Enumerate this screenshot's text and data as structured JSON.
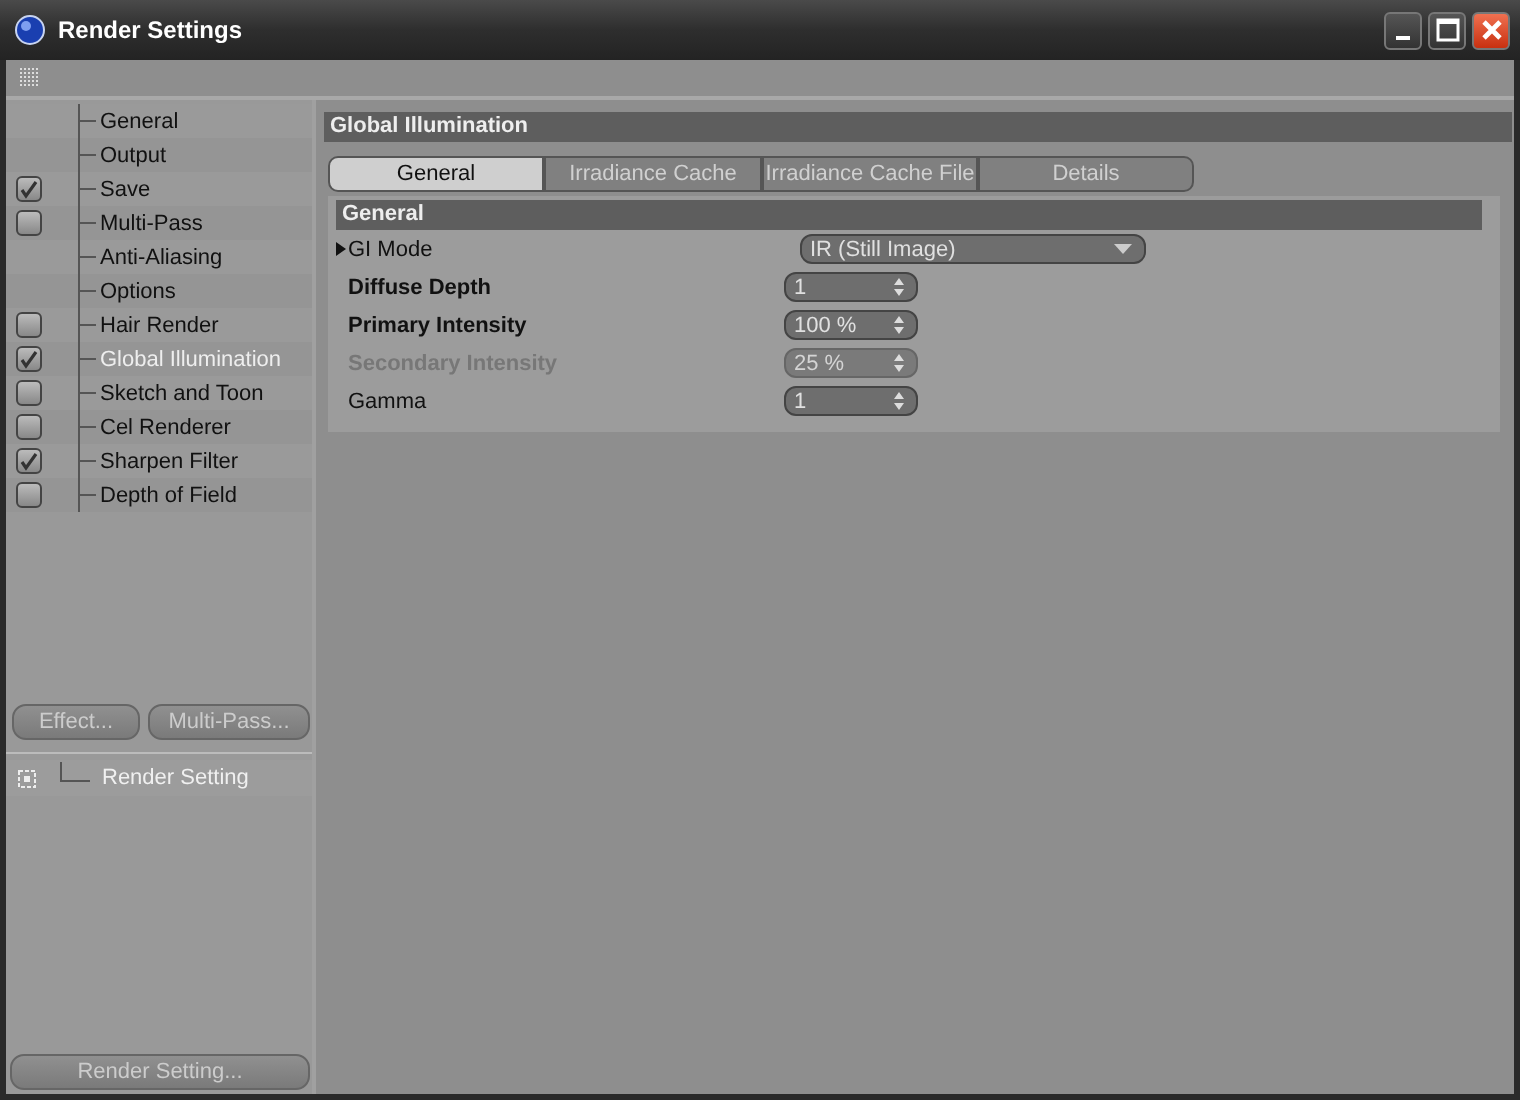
{
  "window": {
    "title": "Render Settings"
  },
  "sidebar": {
    "items": [
      {
        "label": "General",
        "kind": "plain",
        "selected": false
      },
      {
        "label": "Output",
        "kind": "plain",
        "selected": false
      },
      {
        "label": "Save",
        "kind": "checkbox",
        "checked": true,
        "selected": false
      },
      {
        "label": "Multi-Pass",
        "kind": "checkbox",
        "checked": false,
        "selected": false
      },
      {
        "label": "Anti-Aliasing",
        "kind": "plain",
        "selected": false
      },
      {
        "label": "Options",
        "kind": "plain",
        "selected": false
      },
      {
        "label": "Hair Render",
        "kind": "checkbox",
        "checked": false,
        "selected": false
      },
      {
        "label": "Global Illumination",
        "kind": "checkbox",
        "checked": true,
        "selected": true
      },
      {
        "label": "Sketch and Toon",
        "kind": "checkbox",
        "checked": false,
        "selected": false
      },
      {
        "label": "Cel Renderer",
        "kind": "checkbox",
        "checked": false,
        "selected": false
      },
      {
        "label": "Sharpen Filter",
        "kind": "checkbox",
        "checked": true,
        "selected": false
      },
      {
        "label": "Depth of Field",
        "kind": "checkbox",
        "checked": false,
        "selected": false
      }
    ],
    "buttons": [
      "Effect...",
      "Multi-Pass..."
    ],
    "settings": [
      {
        "label": "Render Setting"
      }
    ],
    "bottom_button": "Render Setting..."
  },
  "panel": {
    "title": "Global Illumination",
    "tabs": [
      {
        "label": "General",
        "selected": true
      },
      {
        "label": "Irradiance Cache",
        "selected": false
      },
      {
        "label": "Irradiance Cache File",
        "selected": false
      },
      {
        "label": "Details",
        "selected": false
      }
    ],
    "group": {
      "title": "General",
      "fields": [
        {
          "label": "GI Mode",
          "kind": "dropdown",
          "value": "IR (Still Image)",
          "bold": false,
          "disabled": false
        },
        {
          "label": "Diffuse Depth",
          "kind": "spinner",
          "value": "1",
          "bold": true,
          "disabled": false
        },
        {
          "label": "Primary Intensity",
          "kind": "spinner",
          "value": "100 %",
          "bold": true,
          "disabled": false
        },
        {
          "label": "Secondary Intensity",
          "kind": "spinner",
          "value": "25 %",
          "bold": true,
          "disabled": true
        },
        {
          "label": "Gamma",
          "kind": "spinner",
          "value": "1",
          "bold": false,
          "disabled": false
        }
      ]
    }
  }
}
